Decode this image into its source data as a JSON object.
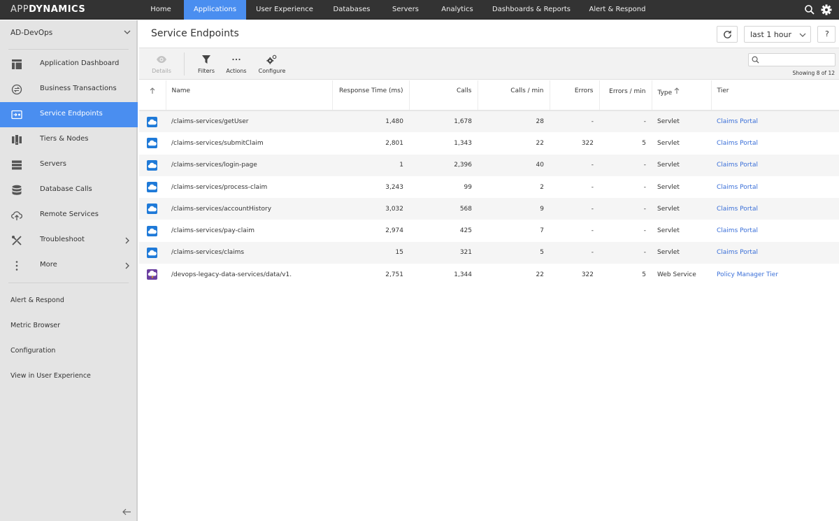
{
  "topnav": {
    "logo_prefix": "APP",
    "logo_suffix": "DYNAMICS",
    "tabs": [
      {
        "label": "Home",
        "active": false
      },
      {
        "label": "Applications",
        "active": true
      },
      {
        "label": "User Experience",
        "active": false
      },
      {
        "label": "Databases",
        "active": false
      },
      {
        "label": "Servers",
        "active": false
      },
      {
        "label": "Analytics",
        "active": false
      },
      {
        "label": "Dashboards & Reports",
        "active": false
      },
      {
        "label": "Alert & Respond",
        "active": false
      }
    ],
    "icons": [
      "search-icon",
      "gear-icon"
    ]
  },
  "sidebar": {
    "app_name": "AD-DevOps",
    "items": [
      {
        "label": "Application Dashboard",
        "icon": "dashboard-icon",
        "active": false
      },
      {
        "label": "Business Transactions",
        "icon": "transactions-icon",
        "active": false
      },
      {
        "label": "Service Endpoints",
        "icon": "service-endpoint-icon",
        "active": true
      },
      {
        "label": "Tiers & Nodes",
        "icon": "tiers-nodes-icon",
        "active": false
      },
      {
        "label": "Servers",
        "icon": "servers-icon",
        "active": false
      },
      {
        "label": "Database Calls",
        "icon": "database-icon",
        "active": false
      },
      {
        "label": "Remote Services",
        "icon": "cloud-upload-icon",
        "active": false
      },
      {
        "label": "Troubleshoot",
        "icon": "tools-icon",
        "active": false,
        "has_submenu": true
      },
      {
        "label": "More",
        "icon": "more-vertical-icon",
        "active": false,
        "has_submenu": true
      }
    ],
    "links": [
      "Alert & Respond",
      "Metric Browser",
      "Configuration",
      "View in User Experience"
    ]
  },
  "header": {
    "title": "Service Endpoints",
    "time_range": "last 1 hour",
    "help_label": "?"
  },
  "toolbar": {
    "details_label": "Details",
    "filters_label": "Filters",
    "actions_label": "Actions",
    "configure_label": "Configure",
    "search_placeholder": "",
    "search_value": "",
    "showing_text": "Showing 8 of 12"
  },
  "table": {
    "columns": [
      "",
      "Name",
      "Response Time (ms)",
      "Calls",
      "Calls / min",
      "Errors",
      "Errors / min",
      "Type",
      "Tier"
    ],
    "rows": [
      {
        "icon": "servlet",
        "name": "/claims-services/getUser",
        "response_time": "1,480",
        "calls": "1,678",
        "calls_per_min": "28",
        "errors": "-",
        "errors_per_min": "-",
        "type": "Servlet",
        "tier": "Claims Portal"
      },
      {
        "icon": "servlet",
        "name": "/claims-services/submitClaim",
        "response_time": "2,801",
        "calls": "1,343",
        "calls_per_min": "22",
        "errors": "322",
        "errors_per_min": "5",
        "type": "Servlet",
        "tier": "Claims Portal"
      },
      {
        "icon": "servlet",
        "name": "/claims-services/login-page",
        "response_time": "1",
        "calls": "2,396",
        "calls_per_min": "40",
        "errors": "-",
        "errors_per_min": "-",
        "type": "Servlet",
        "tier": "Claims Portal"
      },
      {
        "icon": "servlet",
        "name": "/claims-services/process-claim",
        "response_time": "3,243",
        "calls": "99",
        "calls_per_min": "2",
        "errors": "-",
        "errors_per_min": "-",
        "type": "Servlet",
        "tier": "Claims Portal"
      },
      {
        "icon": "servlet",
        "name": "/claims-services/accountHistory",
        "response_time": "3,032",
        "calls": "568",
        "calls_per_min": "9",
        "errors": "-",
        "errors_per_min": "-",
        "type": "Servlet",
        "tier": "Claims Portal"
      },
      {
        "icon": "servlet",
        "name": "/claims-services/pay-claim",
        "response_time": "2,974",
        "calls": "425",
        "calls_per_min": "7",
        "errors": "-",
        "errors_per_min": "-",
        "type": "Servlet",
        "tier": "Claims Portal"
      },
      {
        "icon": "servlet",
        "name": "/claims-services/claims",
        "response_time": "15",
        "calls": "321",
        "calls_per_min": "5",
        "errors": "-",
        "errors_per_min": "-",
        "type": "Servlet",
        "tier": "Claims Portal"
      },
      {
        "icon": "web-service",
        "name": "/devops-legacy-data-services/data/v1.",
        "response_time": "2,751",
        "calls": "1,344",
        "calls_per_min": "22",
        "errors": "322",
        "errors_per_min": "5",
        "type": "Web Service",
        "tier": "Policy Manager Tier"
      }
    ]
  },
  "colors": {
    "accent": "#4a8ef0",
    "topnav_bg": "#333333",
    "sidebar_bg": "#e4e4e4",
    "link": "#3a6fd8",
    "servlet_icon": "#1f7ad8",
    "web_service_icon": "#6b3fa0"
  }
}
